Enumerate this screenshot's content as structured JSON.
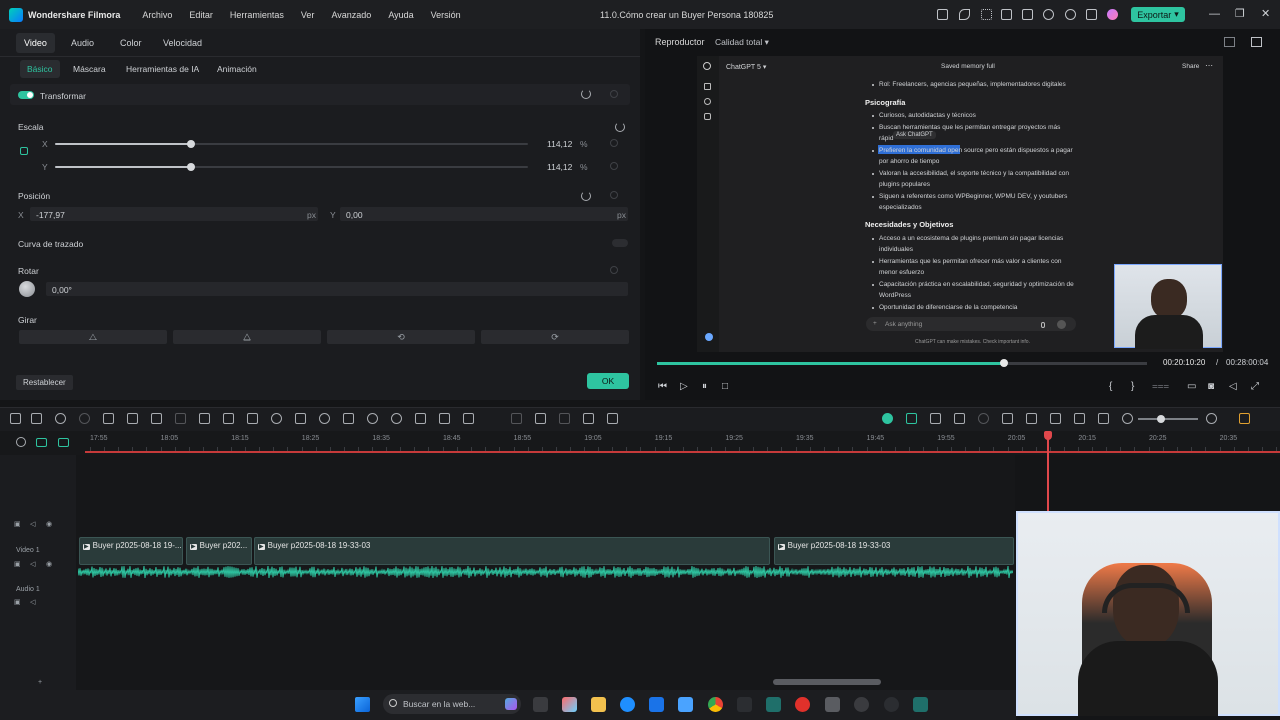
{
  "app": {
    "name": "Wondershare Filmora",
    "project": "11.0.Cómo crear un Buyer Persona 180825",
    "menu": [
      "Archivo",
      "Editar",
      "Herramientas",
      "Ver",
      "Avanzado",
      "Ayuda",
      "Versión"
    ],
    "export_label": "Exportar"
  },
  "props": {
    "tabs": [
      "Video",
      "Audio",
      "Color",
      "Velocidad"
    ],
    "subtabs": [
      "Básico",
      "Máscara",
      "Herramientas de IA",
      "Animación"
    ],
    "transform_label": "Transformar",
    "scale": {
      "label": "Escala",
      "x_axis": "X",
      "y_axis": "Y",
      "x_value": "114,12",
      "y_value": "114,12",
      "unit": "%",
      "x_fraction": 0.2,
      "y_fraction": 0.2
    },
    "position": {
      "label": "Posición",
      "x_axis": "X",
      "y_axis": "Y",
      "x_value": "-177,97",
      "y_value": "0,00",
      "unit": "px"
    },
    "path_curve_label": "Curva de trazado",
    "rotate": {
      "label": "Rotar",
      "value": "0,00°"
    },
    "flip_label": "Girar",
    "reset_label": "Restablecer",
    "ok_label": "OK"
  },
  "player": {
    "title": "Reproductor",
    "quality": "Calidad total",
    "current_time": "00:20:10:20",
    "separator": "/",
    "total_time": "00:28:00:04",
    "progress_fraction": 0.71,
    "chatgpt": {
      "model": "ChatGPT 5",
      "memory": "Saved memory full",
      "share": "Share",
      "line_rol": "Rol: Freelancers, agencias pequeñas, implementadores digitales",
      "h_psico": "Psicografía",
      "p1": "Curiosos, autodidactas y técnicos",
      "p2a": "Buscan herramientas que les permitan entregar proyectos más",
      "p2b": "rápid",
      "ask_chatgpt": "Ask ChatGPT",
      "p3a": "Prefieren la comunidad open source pero están dispuestos a pagar",
      "p3b": "por ahorro de tiempo",
      "p4a": "Valoran la accesibilidad, el soporte técnico y la compatibilidad con",
      "p4b": "plugins populares",
      "p5a": "Siguen a referentes como WPBeginner, WPMU DEV, y youtubers",
      "p5b": "especializados",
      "h_nec": "Necesidades y Objetivos",
      "n1a": "Acceso a un ecosistema de plugins premium sin pagar licencias",
      "n1b": "individuales",
      "n2a": "Herramientas que les permitan ofrecer más valor a clientes con",
      "n2b": "menor esfuerzo",
      "n3a": "Capacitación práctica en escalabilidad, seguridad y optimización de",
      "n3b": "WordPress",
      "n4": "Oportunidad de diferenciarse de la competencia",
      "ask_placeholder": "Ask anything",
      "disclaimer": "ChatGPT can make mistakes. Check important info."
    }
  },
  "timeline": {
    "ruler": [
      "17:55",
      "18:05",
      "18:15",
      "18:25",
      "18:35",
      "18:45",
      "18:55",
      "19:05",
      "19:15",
      "19:25",
      "19:35",
      "19:45",
      "19:55",
      "20:05",
      "20:15",
      "20:25",
      "20:35"
    ],
    "video_track": "Video 1",
    "audio_track": "Audio 1",
    "clips": [
      "Buyer p2025-08-18 19-...",
      "Buyer p202...",
      "Buyer p2025-08-18 19-33-03",
      "Buyer p2025-08-18 19-33-03"
    ]
  },
  "taskbar": {
    "search_placeholder": "Buscar en la web..."
  }
}
